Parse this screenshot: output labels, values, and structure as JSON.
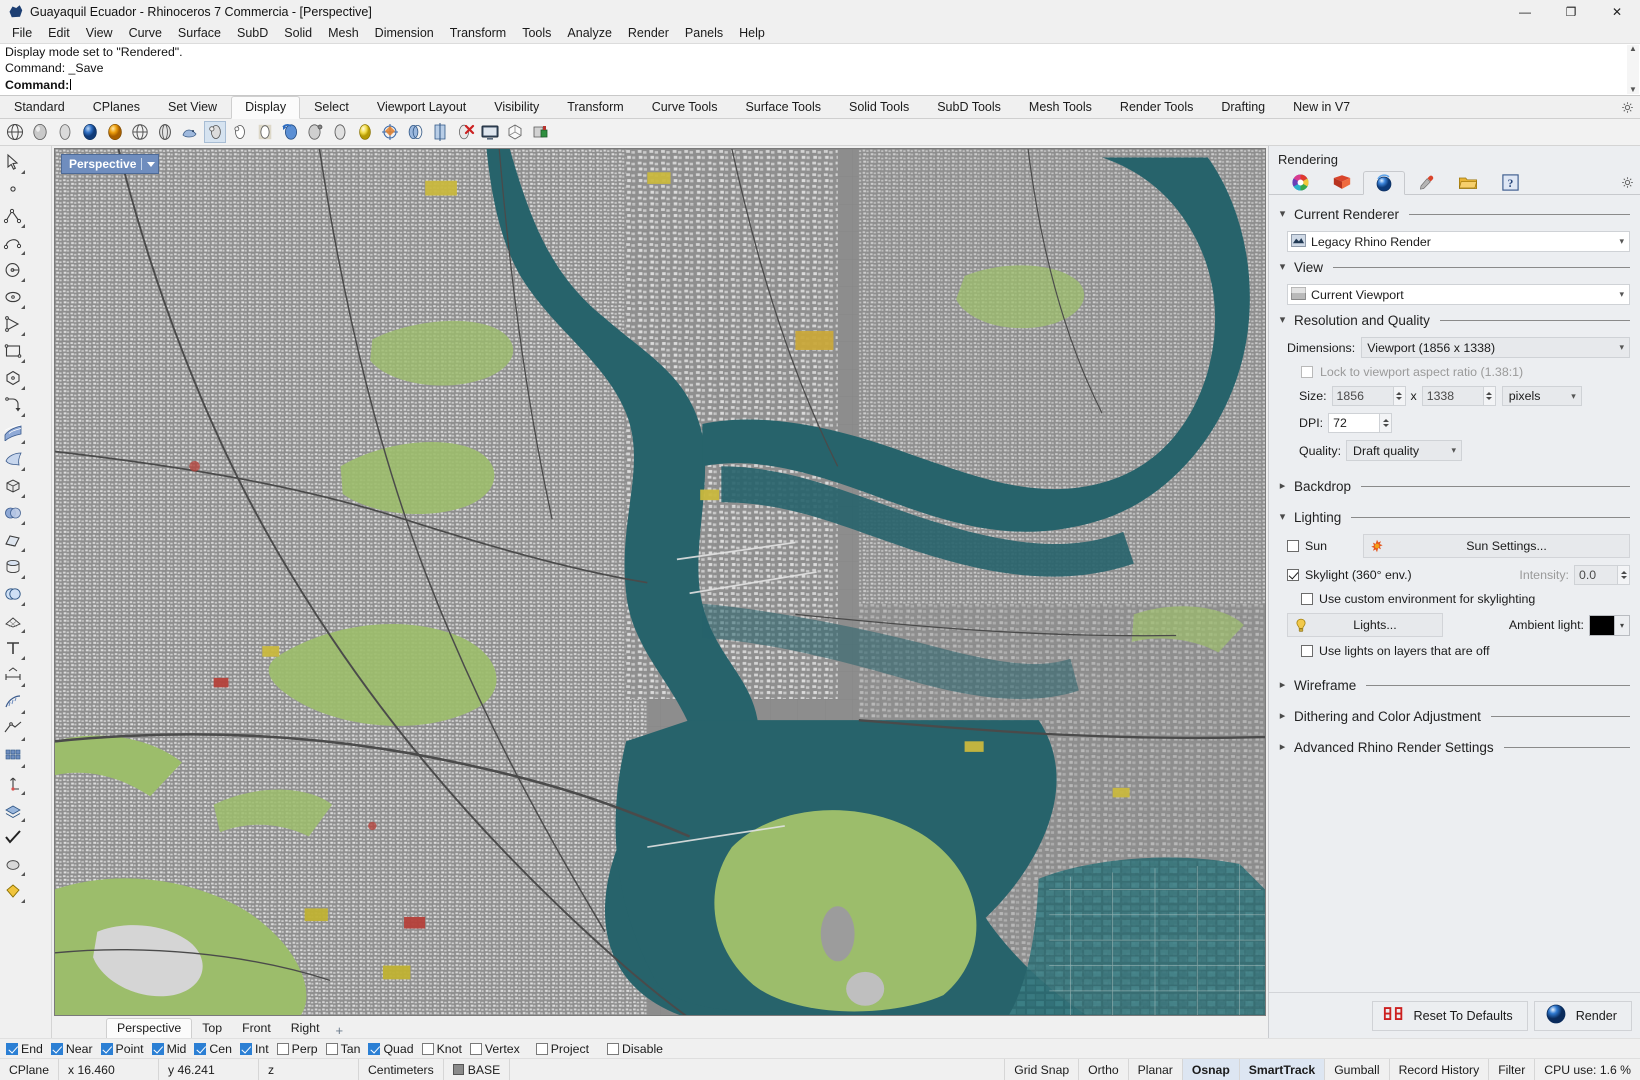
{
  "titlebar": {
    "title": "Guayaquil Ecuador - Rhinoceros 7 Commercia - [Perspective]",
    "minimize": "—",
    "maximize": "❐",
    "close": "✕"
  },
  "menubar": {
    "items": [
      "File",
      "Edit",
      "View",
      "Curve",
      "Surface",
      "SubD",
      "Solid",
      "Mesh",
      "Dimension",
      "Transform",
      "Tools",
      "Analyze",
      "Render",
      "Panels",
      "Help"
    ]
  },
  "command_area": {
    "history_line_1": "Display mode set to \"Rendered\".",
    "history_line_2": "Command: _Save",
    "prompt_label": "Command:",
    "prompt_value": ""
  },
  "toolbar_tabs": {
    "items": [
      "Standard",
      "CPlanes",
      "Set View",
      "Display",
      "Select",
      "Viewport Layout",
      "Visibility",
      "Transform",
      "Curve Tools",
      "Surface Tools",
      "Solid Tools",
      "SubD Tools",
      "Mesh Tools",
      "Render Tools",
      "Drafting",
      "New in V7"
    ],
    "active": "Display"
  },
  "viewport": {
    "label": "Perspective",
    "tabs": [
      "Perspective",
      "Top",
      "Front",
      "Right"
    ],
    "active_tab": "Perspective",
    "add_tab": "+",
    "colors": {
      "land": "#8f8f8f",
      "water": "#27636b",
      "park": "#9cbd6b",
      "park_light": "#a9c77b",
      "road": "#4a4a4a",
      "building": "#d6d6d6",
      "highlight_yellow": "#c9b83e",
      "highlight_red": "#b5413a"
    }
  },
  "right_panel": {
    "title": "Rendering",
    "tabs": [
      {
        "name": "color-wheel-icon",
        "active": false
      },
      {
        "name": "material-icon",
        "active": false
      },
      {
        "name": "render-sphere-icon",
        "active": true
      },
      {
        "name": "eyedropper-icon",
        "active": false
      },
      {
        "name": "folder-icon",
        "active": false
      },
      {
        "name": "help-icon",
        "active": false
      }
    ],
    "sections": {
      "current_renderer": {
        "label": "Current Renderer",
        "expanded": true,
        "value": "Legacy Rhino Render"
      },
      "view": {
        "label": "View",
        "expanded": true,
        "value": "Current Viewport"
      },
      "resolution_quality": {
        "label": "Resolution and Quality",
        "expanded": true,
        "dimensions_label": "Dimensions:",
        "dimensions_value": "Viewport (1856 x 1338)",
        "lock_aspect_label": "Lock to viewport aspect ratio (1.38:1)",
        "lock_aspect_checked": false,
        "size_label": "Size:",
        "size_width": "1856",
        "size_x": "x",
        "size_height": "1338",
        "size_units": "pixels",
        "dpi_label": "DPI:",
        "dpi_value": "72",
        "quality_label": "Quality:",
        "quality_value": "Draft quality"
      },
      "backdrop": {
        "label": "Backdrop",
        "expanded": false
      },
      "lighting": {
        "label": "Lighting",
        "expanded": true,
        "sun_label": "Sun",
        "sun_checked": false,
        "sun_settings_label": "Sun Settings...",
        "skylight_label": "Skylight (360° env.)",
        "skylight_checked": true,
        "intensity_label": "Intensity:",
        "intensity_value": "0.0",
        "custom_env_label": "Use custom environment for skylighting",
        "custom_env_checked": false,
        "lights_label": "Lights...",
        "ambient_label": "Ambient light:",
        "ambient_color": "#000000",
        "lights_off_label": "Use lights on layers that are off",
        "lights_off_checked": false
      },
      "wireframe": {
        "label": "Wireframe",
        "expanded": false
      },
      "dithering": {
        "label": "Dithering and Color Adjustment",
        "expanded": false
      },
      "advanced": {
        "label": "Advanced Rhino Render Settings",
        "expanded": false
      }
    },
    "footer": {
      "reset_label": "Reset To Defaults",
      "render_label": "Render"
    }
  },
  "osnap_bar": {
    "items": [
      {
        "label": "End",
        "checked": true
      },
      {
        "label": "Near",
        "checked": true
      },
      {
        "label": "Point",
        "checked": true
      },
      {
        "label": "Mid",
        "checked": true
      },
      {
        "label": "Cen",
        "checked": true
      },
      {
        "label": "Int",
        "checked": true
      },
      {
        "label": "Perp",
        "checked": false
      },
      {
        "label": "Tan",
        "checked": false
      },
      {
        "label": "Quad",
        "checked": true
      },
      {
        "label": "Knot",
        "checked": false
      },
      {
        "label": "Vertex",
        "checked": false
      },
      {
        "label": "Project",
        "checked": false
      },
      {
        "label": "Disable",
        "checked": false
      }
    ]
  },
  "status_bar": {
    "cplane": "CPlane",
    "x": "x 16.460",
    "y": "y 46.241",
    "z": "z",
    "units": "Centimeters",
    "layer": "BASE",
    "toggles": [
      {
        "label": "Grid Snap",
        "on": false
      },
      {
        "label": "Ortho",
        "on": false
      },
      {
        "label": "Planar",
        "on": false
      },
      {
        "label": "Osnap",
        "on": true
      },
      {
        "label": "SmartTrack",
        "on": true
      },
      {
        "label": "Gumball",
        "on": false
      },
      {
        "label": "Record History",
        "on": false
      },
      {
        "label": "Filter",
        "on": false
      }
    ],
    "cpu": "CPU use: 1.6 %"
  }
}
